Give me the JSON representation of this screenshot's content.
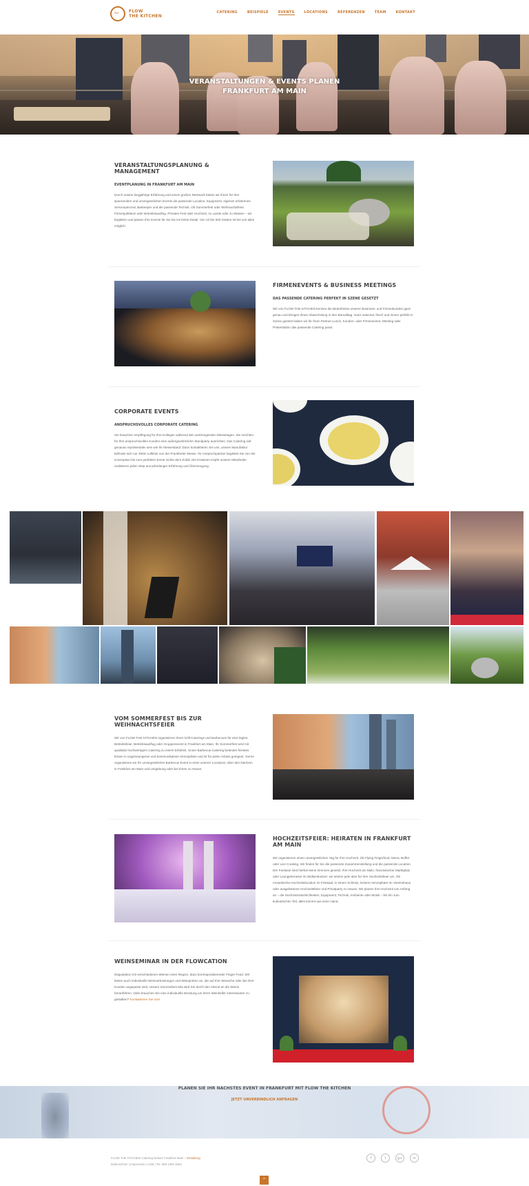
{
  "header": {
    "logo_line1": "FLOW",
    "logo_line2": "THE KITCHEN",
    "nav": [
      "CATERING",
      "BEISPIELE",
      "EVENTS",
      "LOCATIONS",
      "REFERENZEN",
      "TEAM",
      "KONTAKT"
    ],
    "active_nav": "EVENTS"
  },
  "hero": {
    "title_line1": "VERANSTALTUNGEN & EVENTS PLANEN",
    "title_line2": "FRANKFURT AM MAIN"
  },
  "sections": [
    {
      "title": "VERANSTALTUNGSPLANUNG & MANAGEMENT",
      "subtitle": "EVENTPLANUNG IN FRANKFURT AM MAIN",
      "text": "Durch unsere langjährige Erfahrung und einem großen Netzwerk bieten wir Ihnen für Ihre spannenden und unvergesslichen Events die passende Location, Equipment, eigenes erfahrenes Serviceperonal, Barkeeper und die passende Technik. Ob Sommerfest oder Weihnachtsfeier, Firmenjubiläum oder Betriebsausflug, Privates Fest oder Hochzeit, zu Lande oder zu Wasser – wir begleiten und planen Ihre Events für Sie bis ins letzte Detail. Von 10 bis 500 Gästen ist bei uns alles möglich.",
      "image_icon": "picnic-photo"
    },
    {
      "title": "FIRMENEVENTS & BUSINESS MEETINGS",
      "subtitle": "DAS PASSENDE CATERING PERFEKT IN SZENE GESETZT",
      "text": "Wir von FLOW THE KITCHEN kennen die Bedürfnisse unserer Business- und Firmenkunden ganz genau und bringen Ihnen Abwechslung in den Büroalltag. Ganz saisonal, frisch und immer perfekt in Szene gesetzt haben wir für Ihren Partner-Lunch, Kunden- oder Firmenevent, Meeting oder Präsentation das passende Catering parat.",
      "image_icon": "buffet-photo"
    },
    {
      "title": "CORPORATE EVENTS",
      "subtitle": "ANSPRUCHSVOLLES CORPORATE CATERING",
      "text": "Sie brauchen Verpflegung für Ihre Kollegen während den anstrengenden Messetagen. Sie möchten für Ihre anspruchsvollen Kunden eine außergewöhnliche Standparty ausrichten. Das Catering soll genauso repräsentativ sein wie Ihr Messestand. Dann kontaktieren Sie uns, unsere Manufaktur befindet sich nur 450m Luftlinie von der Frankfurter Messe. Ihr Ansprechpartner begleitet Sie von der Konzeption bis zum perfekten Event nichts dem Zufall. Die kreativen Köpfe unserer Mitarbeiter realisieren jeden Step aus jahrelanger Erfahrung und Überzeugung.",
      "image_icon": "soup-spoons-photo"
    },
    {
      "title": "VOM SOMMERFEST BIS ZUR WEIHNACHTSFEIER",
      "subtitle": "",
      "text": "Wir von FLOW THE KITCHEN organisieren Ihren Grill-Caterings und Barbecues für eine legère Betriebsfeier, Betriebsausflug oder Gruppenevent in Frankfurt am Main. Ihr Sommerfest wird mit qualitativ hochwertigem Catering zu einem Erlebnis. Unser Barbecue-Catering bedeutet feinstes Essen in ungezwungener und kommunikativer Atmosphäre und ist für jeden Anlass geeignet. Gerne organisieren wir Ihr unvergessliches Barbecue Event in einer unserer Locations, über den Dächern in Frankfurt am Main und Umgebung oder bei Ihnen zu Hause.",
      "image_icon": "rooftop-grill-photo"
    },
    {
      "title": "HOCHZEITSFEIER: HEIRATEN IN FRANKFURT AM MAIN",
      "subtitle": "",
      "text": "Wir organisieren einen unvergesslichen Tag für Ihre Hochzeit. Ob Flying Fingerfood, Menü, Buffet oder Live Cooking. Wir finden für Sie die passende Zusammenstellung und die passende Location. Der Fantasie sind hierbei keine Grenzen gesetzt. Ihre Hochzeit am Main, französischer Marktplatz oder Loungeterrasse im Wolkenkratzer; wir setzen jede Idee für Ihre Hochzeitsfeier um. Ob romantische Hochzeitslocation im Festsaal, in einem Schloss, lockere Atmosphäre im Vereinshaus oder ausgelassene Hochzeitsfeier und Privatparty zu Hause. Wir planen Ihre Hochzeit von Anfang an – die Hochzeitsräumlichkeiten, Equipment, Technik, Ambiente oder Musik – bis hin zum kulinarischen Teil, alles kommt aus einer Hand.",
      "image_icon": "wedding-hall-photo"
    },
    {
      "title": "WEINSEMINAR IN DER FLOWCATION",
      "subtitle": "",
      "text": "Degustation mit verschiedenen Weinen einer Region, dazu korrespondierender Finger Food. Wir bieten auch individuelle Weinverkostungen und Weinproben an, die auf Ihre Wünsche oder die Ihrer Kunden angepasst sind. Unsere Sommeliers Mia wird Sie durch den Abend an die Weine heranführen. Oder brauchen Sie eine individuelle Beratung um Ihren Weinkeller interessanter zu gestalten?",
      "link": "Kontaktieren Sie uns!",
      "image_icon": "flowcation-room-photo"
    }
  ],
  "cta": {
    "title": "PLANEN SIE IHR NÄCHSTES EVENT IN FRANKFURT MIT FLOW THE KITCHEN",
    "link": "JETZT UNVERBINDLICH ANFRAGEN"
  },
  "footer": {
    "line1": "FLOW THE KITCHEN Catering Deluxe Frankfurt Main",
    "line1_link": "Einladung",
    "line2": "Datenschutz | Impressum | AGB | Tel. 069 1381 8451",
    "social": [
      "f",
      "t",
      "g+",
      "in"
    ]
  },
  "to_top": "^"
}
